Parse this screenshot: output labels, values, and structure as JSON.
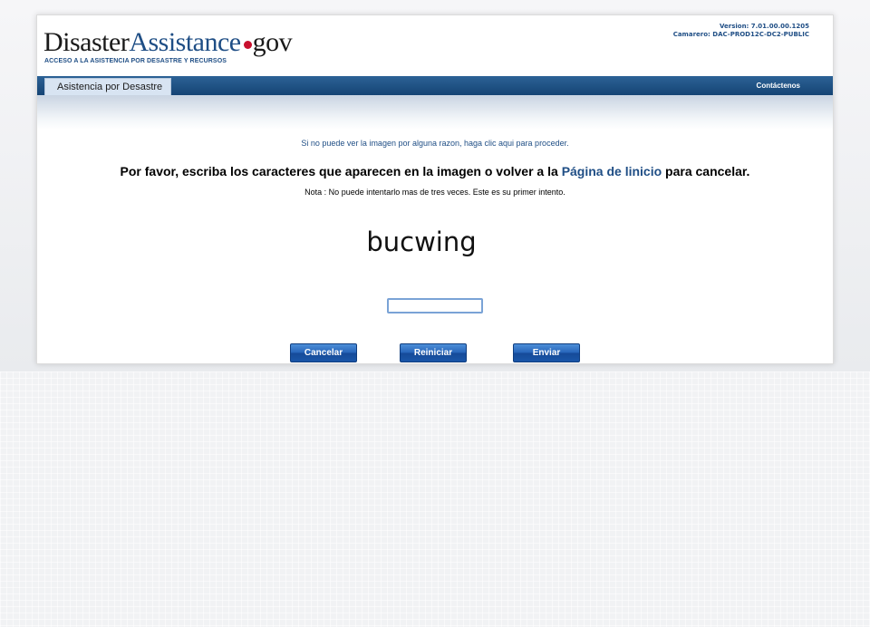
{
  "header": {
    "logo": {
      "word1": "Disaster",
      "word2": "Assistance",
      "word3": "gov"
    },
    "tagline": "ACCESO A LA ASISTENCIA POR DESASTRE Y RECURSOS",
    "version": "Version: 7.01.00.00.1205",
    "server": "Camarero: DAC-PROD12C-DC2-PUBLIC"
  },
  "nav": {
    "tab": "Asistencia por Desastre",
    "contact": "Contáctenos"
  },
  "content": {
    "notice": "Si no puede ver la imagen por alguna razon, haga clic aqui para proceder.",
    "instruction_before": "Por favor, escriba los caracteres que aparecen en la imagen o volver a la ",
    "instruction_link": "Página de linicio",
    "instruction_after": " para cancelar.",
    "note": "Nota : No puede intentarlo mas de tres veces. Este es su primer intento.",
    "captcha_text": "bucwing",
    "input_value": ""
  },
  "buttons": {
    "cancel": "Cancelar",
    "reset": "Reiniciar",
    "submit": "Enviar"
  },
  "colors": {
    "brand_blue": "#1f4e85",
    "logo_dot": "#c8102e",
    "nav_bar": "#154474",
    "button_blue": "#2563b8"
  }
}
